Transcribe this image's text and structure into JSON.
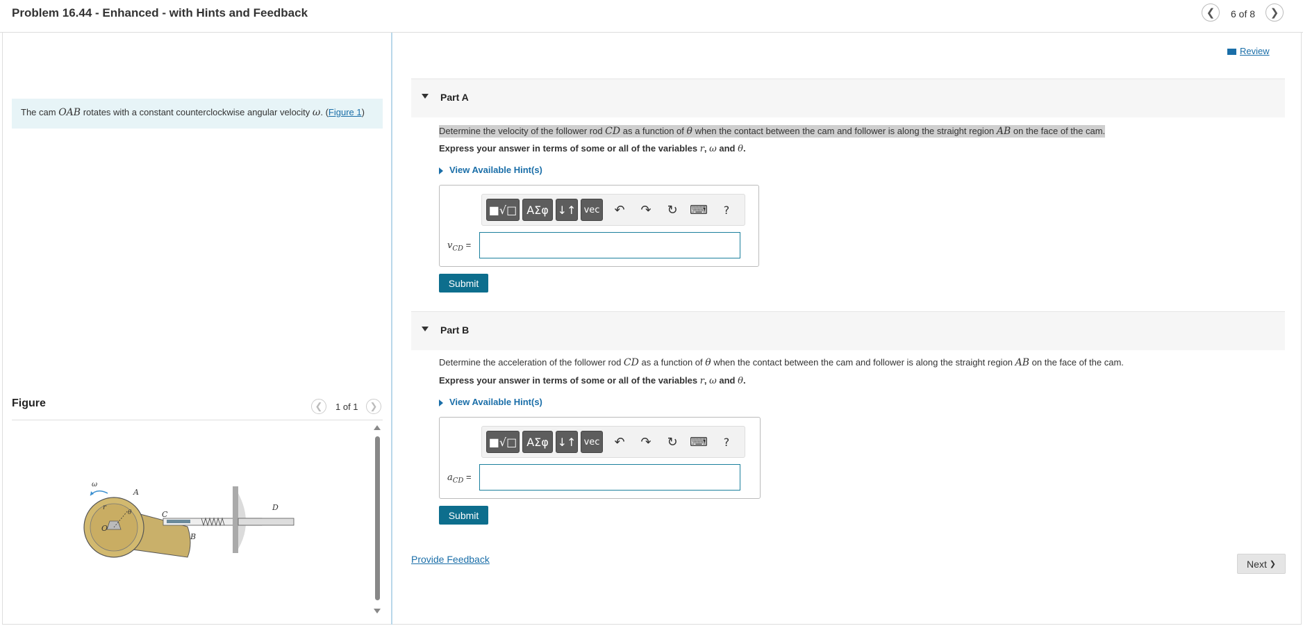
{
  "header": {
    "title": "Problem 16.44 - Enhanced - with Hints and Feedback",
    "pager": "6 of 8",
    "prev_icon": "chevron-left",
    "next_icon": "chevron-right"
  },
  "review": {
    "label": "Review"
  },
  "intro": {
    "prefix": "The cam ",
    "cam": "OAB",
    "middle": " rotates with a constant counterclockwise angular velocity ",
    "omega": "ω",
    "suffix_open": ". (",
    "link": "Figure 1",
    "suffix_close": ")"
  },
  "figure": {
    "label": "Figure",
    "pager": "1 of 1",
    "labels": {
      "omega": "ω",
      "A": "A",
      "O": "O",
      "r": "r",
      "theta": "θ",
      "C": "C",
      "B": "B",
      "D": "D"
    }
  },
  "parts": [
    {
      "label": "Part A",
      "question": {
        "t1": "Determine the velocity of the follower rod ",
        "m1": "CD",
        "t2": " as a function of ",
        "m2": "θ",
        "t3": " when the contact between the cam and follower is along the straight region ",
        "m3": "AB",
        "t4": " on the face of the cam."
      },
      "instruction": {
        "t1": "Express your answer in terms of some or all of the variables ",
        "m1": "r",
        "t2": ", ",
        "m2": "ω",
        "t3": " and ",
        "m3": "θ",
        "t4": "."
      },
      "hint": "View Available Hint(s)",
      "var_main": "v",
      "var_sub": "CD",
      "var_eq": " =",
      "submit": "Submit"
    },
    {
      "label": "Part B",
      "question": {
        "t1": "Determine the acceleration of the follower rod ",
        "m1": "CD",
        "t2": " as a function of ",
        "m2": "θ",
        "t3": " when the contact between the cam and follower is along the straight region ",
        "m3": "AB",
        "t4": " on the face of the cam."
      },
      "instruction": {
        "t1": "Express your answer in terms of some or all of the variables ",
        "m1": "r",
        "t2": ", ",
        "m2": "ω",
        "t3": " and ",
        "m3": "θ",
        "t4": "."
      },
      "hint": "View Available Hint(s)",
      "var_main": "a",
      "var_sub": "CD",
      "var_eq": " =",
      "submit": "Submit"
    }
  ],
  "toolbar": {
    "templates": "■√□",
    "greek": "ΑΣφ",
    "arrows": "↓↑",
    "vec": "vec",
    "undo": "↶",
    "redo": "↷",
    "reset": "↻",
    "keyboard": "⌨",
    "help": "?"
  },
  "footer": {
    "feedback": "Provide Feedback",
    "next": "Next",
    "next_icon": "❯"
  }
}
